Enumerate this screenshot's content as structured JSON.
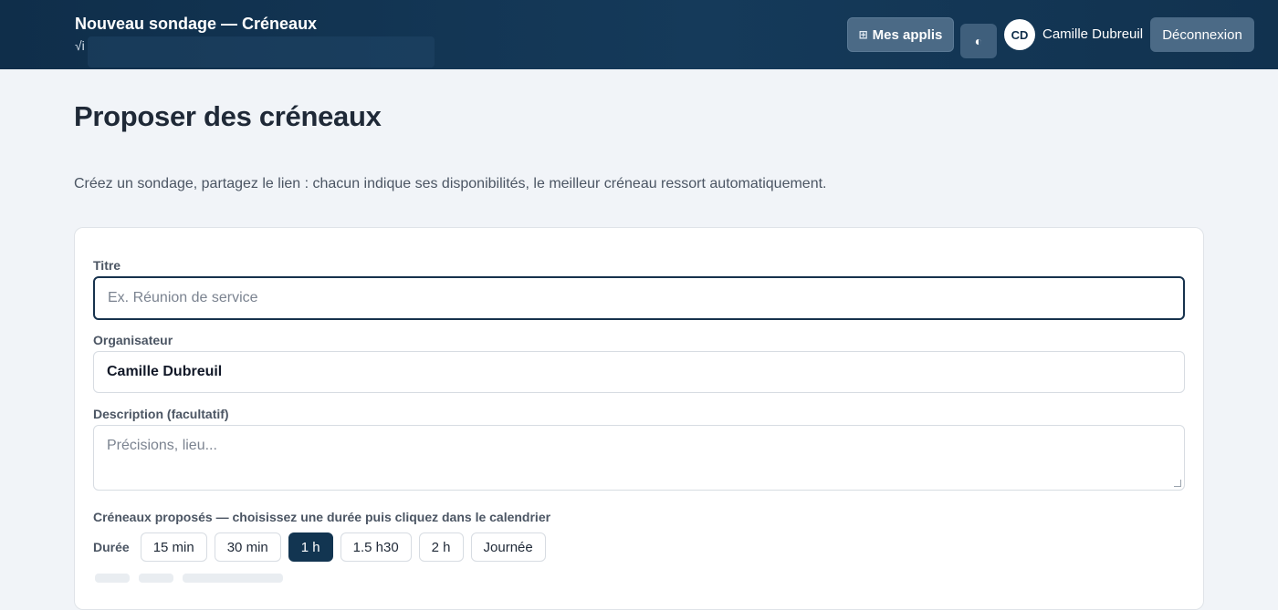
{
  "header": {
    "title": "Nouveau sondage — Créneaux",
    "subtitle": "√i",
    "apps_icon": "grid-icon",
    "apps_icon_glyph": "⊞",
    "apps_label": "Mes applis",
    "theme_icon": "contrast-icon",
    "theme_icon_glyph": "◐",
    "avatar_initials": "CD",
    "user_name": "Camille Dubreuil",
    "logout_label": "Déconnexion"
  },
  "page": {
    "title": "Proposer des créneaux",
    "intro": "Créez un sondage, partagez le lien : chacun indique ses disponibilités, le meilleur créneau ressort automatiquement."
  },
  "form": {
    "title_label": "Titre",
    "title_placeholder": "Ex. Réunion de service",
    "title_value": "",
    "organizer_label": "Organisateur",
    "organizer_value": "Camille Dubreuil",
    "description_label": "Description (facultatif)",
    "description_placeholder": "Précisions, lieu...",
    "description_value": "",
    "slots_label": "Créneaux proposés — choisissez une durée puis cliquez dans le calendrier",
    "duration_label": "Durée",
    "durations": [
      "15 min",
      "30 min",
      "1 h",
      "1.5 h30",
      "2 h",
      "Journée"
    ],
    "selected_duration": "1 h"
  },
  "colors": {
    "header_bg": "#0f2e4a",
    "accent": "#123551",
    "page_bg": "#f1f4f8"
  }
}
